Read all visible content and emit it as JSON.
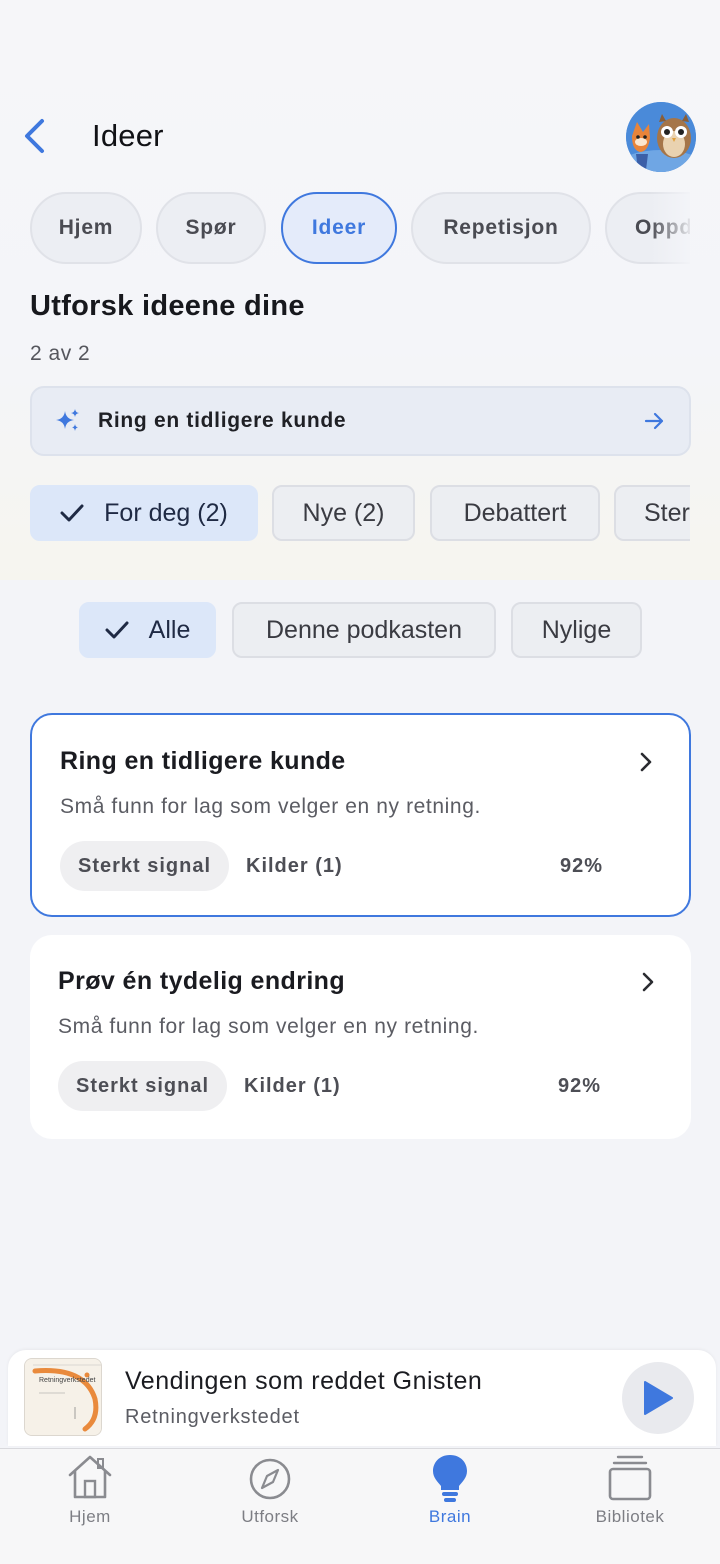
{
  "header": {
    "title": "Ideer"
  },
  "tabs": [
    {
      "label": "Hjem"
    },
    {
      "label": "Spør"
    },
    {
      "label": "Ideer",
      "active": true
    },
    {
      "label": "Repetisjon"
    },
    {
      "label": "Oppd"
    }
  ],
  "section": {
    "title": "Utforsk ideene dine",
    "count": "2 av 2"
  },
  "suggestion": {
    "text": "Ring en tidligere kunde"
  },
  "filters": [
    {
      "label": "For deg (2)",
      "active": true
    },
    {
      "label": "Nye (2)"
    },
    {
      "label": "Debattert"
    },
    {
      "label": "Ster"
    }
  ],
  "scope": [
    {
      "label": "Alle",
      "active": true
    },
    {
      "label": "Denne podkasten"
    },
    {
      "label": "Nylige"
    }
  ],
  "cards": [
    {
      "title": "Ring en tidligere kunde",
      "description": "Små funn for lag som velger en ny retning.",
      "badge": "Sterkt signal",
      "sources": "Kilder (1)",
      "score": "92%",
      "selected": true
    },
    {
      "title": "Prøv én tydelig endring",
      "description": "Små funn for lag som velger en ny retning.",
      "badge": "Sterkt signal",
      "sources": "Kilder (1)",
      "score": "92%"
    }
  ],
  "player": {
    "title": "Vendingen som reddet Gnisten",
    "subtitle": "Retningverkstedet",
    "art_label": "Retningverkstedet"
  },
  "tabbar": [
    {
      "label": "Hjem",
      "icon": "home-icon"
    },
    {
      "label": "Utforsk",
      "icon": "compass-icon"
    },
    {
      "label": "Brain",
      "icon": "lightbulb-icon",
      "active": true
    },
    {
      "label": "Bibliotek",
      "icon": "library-icon"
    }
  ],
  "colors": {
    "accent": "#3f78de",
    "background": "#f3f4f8"
  }
}
